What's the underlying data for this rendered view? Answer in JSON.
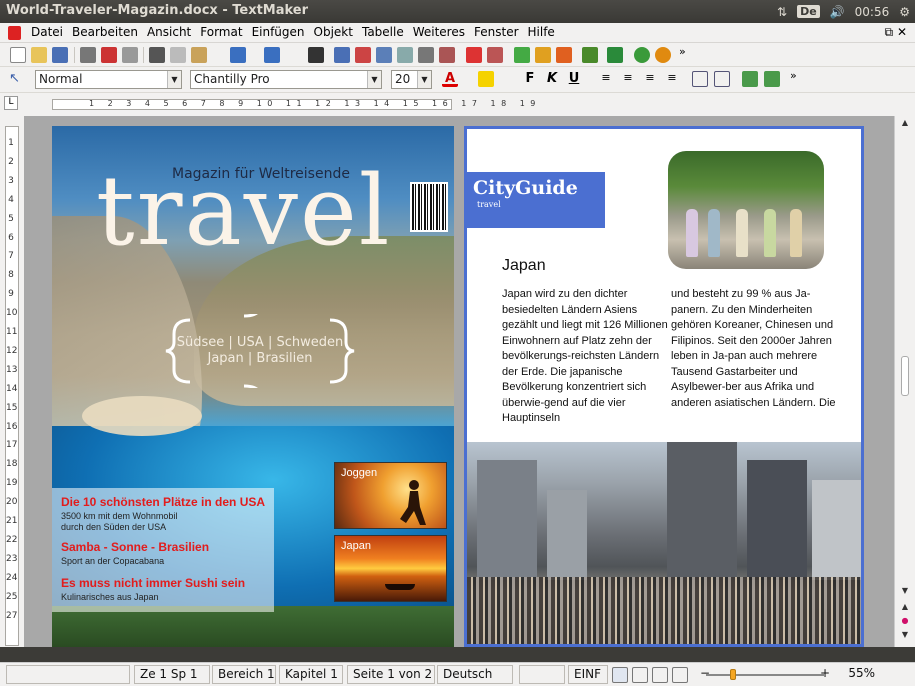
{
  "window": {
    "title": "World-Traveler-Magazin.docx - TextMaker"
  },
  "tray": {
    "lang": "De",
    "time": "00:56"
  },
  "menu": {
    "items": [
      "Datei",
      "Bearbeiten",
      "Ansicht",
      "Format",
      "Einfügen",
      "Objekt",
      "Tabelle",
      "Weiteres",
      "Fenster",
      "Hilfe"
    ]
  },
  "format_toolbar": {
    "style": "Normal",
    "font": "Chantilly Pro",
    "size": "20"
  },
  "ruler": {
    "marks": "1 2 3 4 5 6 7 8 9 10 11 12 13 14 15 16 17 18 19"
  },
  "vruler": {
    "numbers": [
      "1",
      "2",
      "3",
      "4",
      "5",
      "6",
      "7",
      "8",
      "9",
      "10",
      "11",
      "12",
      "13",
      "14",
      "15",
      "16",
      "17",
      "18",
      "19",
      "20",
      "21",
      "22",
      "23",
      "24",
      "25",
      "27"
    ]
  },
  "left_page": {
    "kicker": "Magazin für Weltreisende",
    "masthead": "travel",
    "destinations_line1": "Südsee | USA | Schweden",
    "destinations_line2": "Japan | Brasilien",
    "stories": [
      {
        "headline": "Die 10 schönsten Plätze in den USA",
        "sub": "3500 km mit dem Wohnmobil durch den Süden der USA"
      },
      {
        "headline": "Samba - Sonne - Brasilien",
        "sub": "Sport an der Copacabana"
      },
      {
        "headline": "Es muss nicht immer Sushi sein",
        "sub": "Kulinarisches aus Japan"
      }
    ],
    "thumb1_label": "Joggen",
    "thumb2_label": "Japan"
  },
  "right_page": {
    "badge_title": "CityGuide",
    "badge_sub": "travel",
    "heading": "Japan",
    "col1": "Japan wird zu den dichter besiedelten Ländern Asiens gezählt und liegt mit 126 Millionen Einwohnern auf Platz zehn der bevölkerungs-reichsten Ländern der Erde. Die japanische Bevölkerung konzentriert sich überwie-gend auf die vier Hauptinseln",
    "col2": "und besteht zu 99 % aus Ja-panern. Zu den Minderheiten gehören Koreaner, Chinesen und Filipinos. Seit den 2000er Jahren leben in Ja-pan auch mehrere Tausend Gastarbeiter und Asylbewer-ber aus Afrika und anderen asiatischen Ländern. Die"
  },
  "status": {
    "pos": "Ze 1 Sp 1",
    "area": "Bereich 1",
    "chapter": "Kapitel 1",
    "page": "Seite 1 von 2",
    "lang": "Deutsch",
    "mode": "EINF",
    "zoom": "55%",
    "zoom_fraction": 0.23
  },
  "colors": {
    "accent": "#4b6fd1",
    "headline_red": "#e21c1c"
  }
}
